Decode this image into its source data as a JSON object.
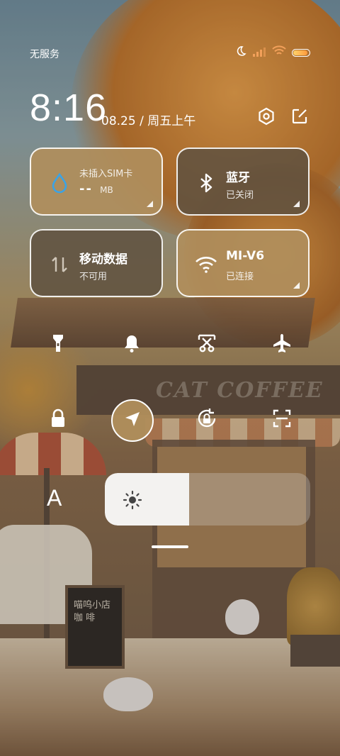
{
  "status_bar": {
    "carrier": "无服务",
    "icons": [
      "moon-icon",
      "signal-icon",
      "wifi-icon",
      "battery-icon"
    ]
  },
  "header": {
    "time": "8:16",
    "date": "08.25 / 周五上午",
    "icons": [
      "settings-icon",
      "edit-icon"
    ]
  },
  "tiles": [
    {
      "name": "sim-data-usage",
      "title": "未插入SIM卡",
      "value": "--",
      "unit": "MB",
      "icon": "water-drop-icon",
      "active": true
    },
    {
      "name": "bluetooth",
      "title": "蓝牙",
      "sub": "已关闭",
      "icon": "bluetooth-icon",
      "active": false
    },
    {
      "name": "mobile-data",
      "title": "移动数据",
      "sub": "不可用",
      "icon": "data-arrows-icon",
      "active": false
    },
    {
      "name": "wifi",
      "title": "MI-V6",
      "sub": "已连接",
      "icon": "wifi-icon",
      "active": true
    }
  ],
  "toggles_row1": [
    {
      "name": "flashlight",
      "icon": "flashlight-icon",
      "on": false
    },
    {
      "name": "sound",
      "icon": "bell-icon",
      "on": true
    },
    {
      "name": "screenshot",
      "icon": "scissors-icon",
      "on": false
    },
    {
      "name": "airplane-mode",
      "icon": "airplane-icon",
      "on": false
    }
  ],
  "toggles_row2": [
    {
      "name": "lock-screen",
      "icon": "lock-icon",
      "on": false
    },
    {
      "name": "location",
      "icon": "location-arrow-icon",
      "on": true
    },
    {
      "name": "rotation-lock",
      "icon": "rotation-lock-icon",
      "on": false
    },
    {
      "name": "scanner",
      "icon": "scan-icon",
      "on": false
    }
  ],
  "brightness": {
    "auto_label": "A",
    "level": 0.41
  },
  "wallpaper": {
    "sign_text": "CAT COFFEE",
    "board_text": [
      "喵呜小店",
      "咖 啡"
    ]
  },
  "colors": {
    "tile_active": "#b08e5c",
    "tile_inactive": "#605240",
    "accent_battery": "#ffb050"
  }
}
